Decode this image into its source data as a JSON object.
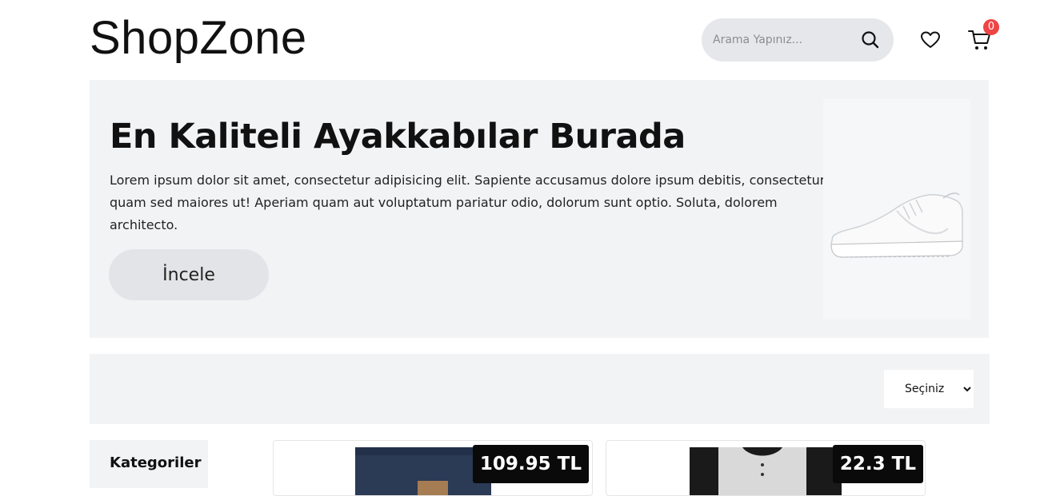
{
  "header": {
    "logo": "ShopZone",
    "search_placeholder": "Arama Yapınız...",
    "cart_count": "0"
  },
  "hero": {
    "title": "En Kaliteli Ayakkabılar Burada",
    "text": "Lorem ipsum dolor sit amet, consectetur adipisicing elit. Sapiente accusamus dolore ipsum debitis, consectetur quam sed maiores ut! Aperiam quam aut voluptatum pariatur odio, dolorum sunt optio. Soluta, dolorem architecto.",
    "button_label": "İncele"
  },
  "filter": {
    "selected": "Seçiniz"
  },
  "sidebar": {
    "title": "Kategoriler"
  },
  "products": [
    {
      "price": "109.95 TL"
    },
    {
      "price": "22.3 TL"
    }
  ],
  "colors": {
    "panel": "#f2f3f5",
    "badge": "#ef4444",
    "price_bg": "#0a0a0a"
  }
}
